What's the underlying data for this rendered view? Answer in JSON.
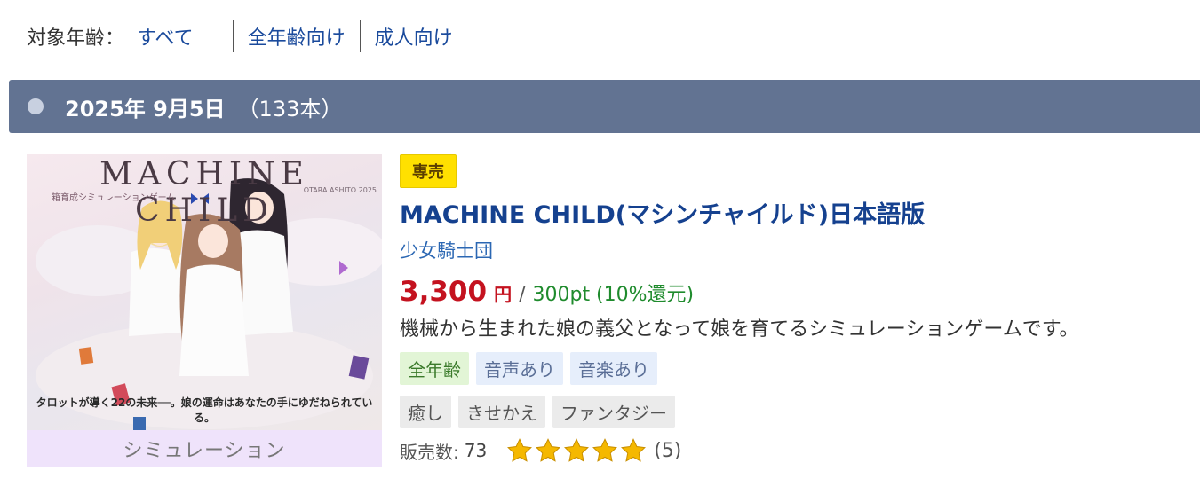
{
  "age_filter": {
    "label": "対象年齢：",
    "options": [
      "すべて",
      "全年齢向け",
      "成人向け"
    ]
  },
  "date_header": {
    "date": "2025年 9月5日",
    "count": "（133本）"
  },
  "item": {
    "thumbnail": {
      "logo_text": "MACHINE CHILD",
      "subtitle_small": "箱育成シミュレーションゲーム",
      "credit": "OTARA ASHITO 2025",
      "caption": "タロットが導く22の未来──。娘の運命はあなたの手にゆだねられている。"
    },
    "genre_label": "シミュレーション",
    "badge": "専売",
    "title": "MACHINE CHILD(マシンチャイルド)日本語版",
    "circle": "少女騎士団",
    "price": "3,300",
    "currency": "円",
    "separator": "/",
    "points": "300pt (10%還元)",
    "description": "機械から生まれた娘の義父となって娘を育てるシミュレーションゲームです。",
    "tags_row1": [
      {
        "label": "全年齢",
        "kind": "age"
      },
      {
        "label": "音声あり",
        "kind": "feat"
      },
      {
        "label": "音楽あり",
        "kind": "feat"
      }
    ],
    "tags_row2": [
      {
        "label": "癒し",
        "kind": "genre"
      },
      {
        "label": "きせかえ",
        "kind": "genre"
      },
      {
        "label": "ファンタジー",
        "kind": "genre"
      }
    ],
    "sales_label": "販売数:",
    "sales_value": "73",
    "rating_stars": 5,
    "review_count": "(5)",
    "star_color": "#f5b800"
  }
}
